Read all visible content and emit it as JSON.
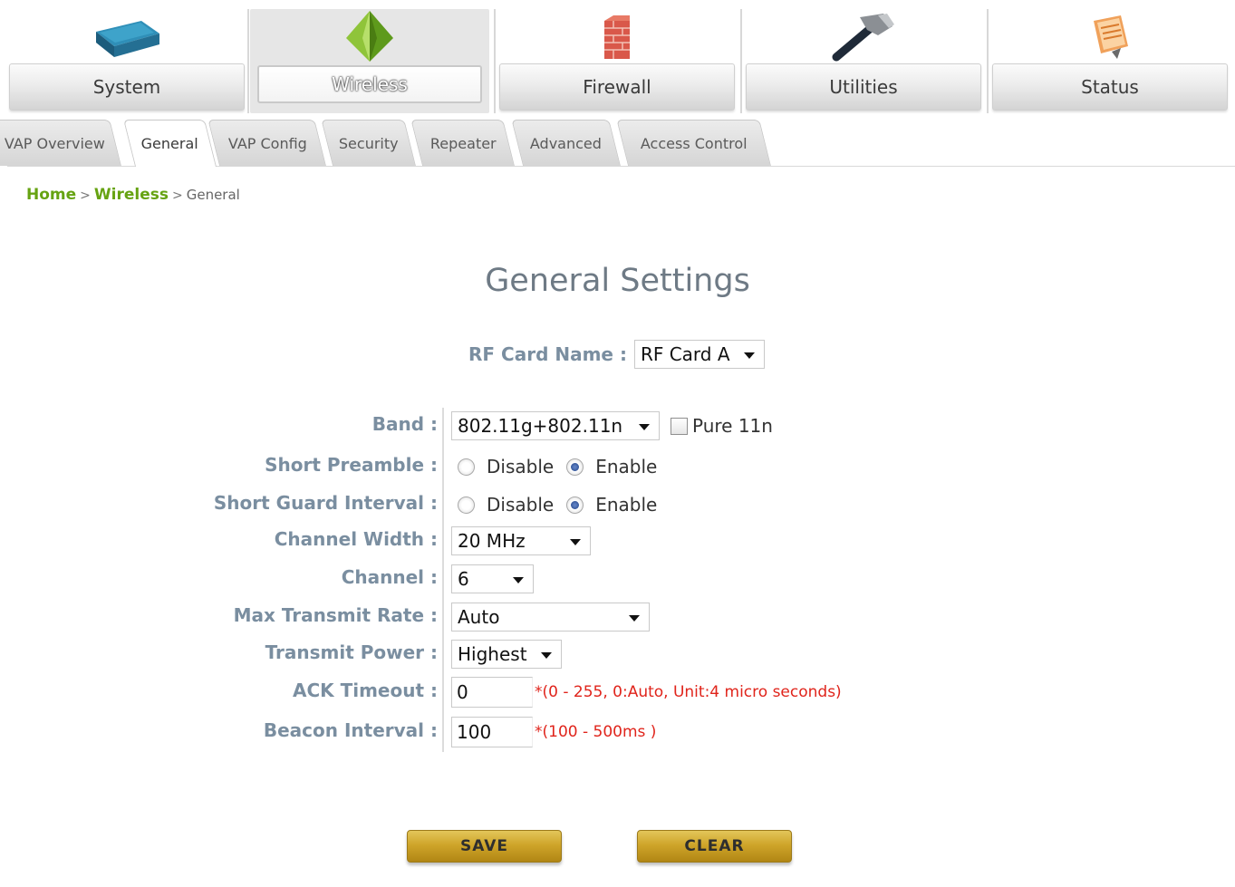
{
  "nav": {
    "items": [
      {
        "label": "System",
        "icon": "router-icon"
      },
      {
        "label": "Wireless",
        "icon": "antenna-icon",
        "active": true
      },
      {
        "label": "Firewall",
        "icon": "brick-wall-icon"
      },
      {
        "label": "Utilities",
        "icon": "hammer-icon"
      },
      {
        "label": "Status",
        "icon": "clipboard-icon"
      }
    ]
  },
  "tabs": [
    {
      "label": "VAP Overview"
    },
    {
      "label": "General",
      "active": true
    },
    {
      "label": "VAP Config"
    },
    {
      "label": "Security"
    },
    {
      "label": "Repeater"
    },
    {
      "label": "Advanced"
    },
    {
      "label": "Access Control"
    }
  ],
  "breadcrumb": {
    "home": "Home",
    "sep": ">",
    "section": "Wireless",
    "current": "General"
  },
  "page_title": "General Settings",
  "rf_card": {
    "label": "RF Card Name :",
    "value": "RF Card A"
  },
  "form": {
    "band": {
      "label": "Band :",
      "value": "802.11g+802.11n",
      "pure_label": "Pure 11n",
      "pure_checked": false
    },
    "short_preamble": {
      "label": "Short Preamble :",
      "options": [
        "Disable",
        "Enable"
      ],
      "selected": "Enable"
    },
    "short_guard": {
      "label": "Short Guard Interval :",
      "options": [
        "Disable",
        "Enable"
      ],
      "selected": "Enable"
    },
    "channel_width": {
      "label": "Channel Width :",
      "value": "20 MHz"
    },
    "channel": {
      "label": "Channel :",
      "value": "6"
    },
    "max_rate": {
      "label": "Max Transmit Rate :",
      "value": "Auto"
    },
    "tx_power": {
      "label": "Transmit Power :",
      "value": "Highest"
    },
    "ack_timeout": {
      "label": "ACK Timeout :",
      "value": "0",
      "hint": "*(0 - 255, 0:Auto, Unit:4 micro seconds)"
    },
    "beacon": {
      "label": "Beacon Interval :",
      "value": "100",
      "hint": "*(100 - 500ms )"
    }
  },
  "buttons": {
    "save": "SAVE",
    "clear": "CLEAR"
  },
  "colors": {
    "label": "#7a8ea0",
    "breadcrumb_link": "#66a312",
    "hint": "#e0241b",
    "button_gold": "#cfa52a",
    "title": "#6e7a85"
  }
}
